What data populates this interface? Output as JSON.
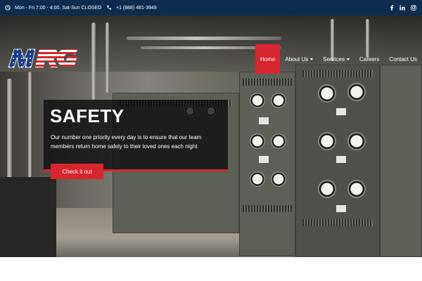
{
  "topbar": {
    "hours": "Mon - Fri 7:00 - 4:00. Sat-Sun CLOSED",
    "phone": "+1 (888) 481-3949",
    "icons": [
      "clock-icon",
      "phone-icon",
      "facebook-icon",
      "linkedin-icon",
      "instagram-icon"
    ]
  },
  "nav": {
    "items": [
      {
        "label": "Home",
        "active": true,
        "dropdown": false
      },
      {
        "label": "About Us",
        "active": false,
        "dropdown": true
      },
      {
        "label": "Services",
        "active": false,
        "dropdown": true
      },
      {
        "label": "Careers",
        "active": false,
        "dropdown": false
      },
      {
        "label": "Contact Us",
        "active": false,
        "dropdown": false
      }
    ]
  },
  "hero": {
    "title": "SAFETY",
    "text": "Our number one priority every day is to ensure that our team members return home safely to their loved ones each night",
    "cta_label": "Check it out"
  },
  "colors": {
    "topbar": "#0d2c4f",
    "accent": "#d7262d"
  }
}
